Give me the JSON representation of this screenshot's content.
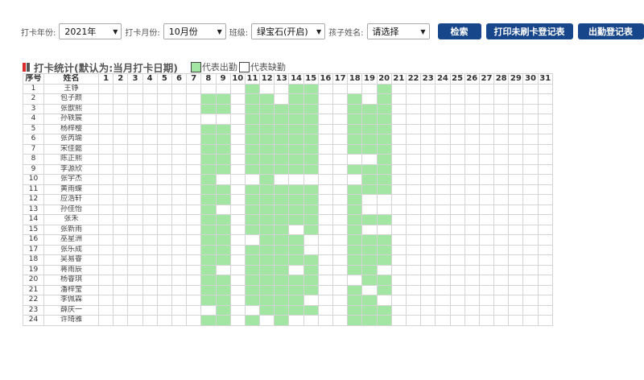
{
  "filters": {
    "year_label": "打卡年份:",
    "year_value": "2021年",
    "month_label": "打卡月份:",
    "month_value": "10月份",
    "class_label": "班级:",
    "class_value": "绿宝石(开启)",
    "child_label": "孩子姓名:",
    "child_value": "请选择"
  },
  "buttons": {
    "search": "检索",
    "print_unswiped": "打印未刷卡登记表",
    "attendance_register": "出勤登记表"
  },
  "section": {
    "title": "打卡统计(默认为:当月打卡日期)",
    "legend_present": "代表出勤",
    "legend_absent": "代表缺勤",
    "accent_colors": [
      "#d92b2b",
      "#555555"
    ]
  },
  "colors": {
    "present": "#a3e6a3",
    "button": "#17478a"
  },
  "table": {
    "headers": {
      "seq": "序号",
      "name": "姓名"
    },
    "days": [
      1,
      2,
      3,
      4,
      5,
      6,
      7,
      8,
      9,
      10,
      11,
      12,
      13,
      14,
      15,
      16,
      17,
      18,
      19,
      20,
      21,
      22,
      23,
      24,
      25,
      26,
      27,
      28,
      29,
      30,
      31
    ],
    "rows": [
      {
        "seq": "1",
        "name": "王铮",
        "present": [
          11,
          14,
          15,
          20
        ]
      },
      {
        "seq": "2",
        "name": "包子颜",
        "present": [
          8,
          9,
          11,
          12,
          14,
          15,
          18,
          20
        ]
      },
      {
        "seq": "3",
        "name": "张歆熙",
        "present": [
          8,
          9,
          11,
          12,
          13,
          14,
          15,
          18,
          19,
          20
        ]
      },
      {
        "seq": "4",
        "name": "孙轶宸",
        "present": [
          11,
          12,
          13,
          14,
          15,
          18,
          19,
          20
        ]
      },
      {
        "seq": "5",
        "name": "杨梓樱",
        "present": [
          8,
          9,
          11,
          12,
          13,
          14,
          15,
          18,
          19,
          20
        ]
      },
      {
        "seq": "6",
        "name": "张芮瑜",
        "present": [
          8,
          9,
          11,
          12,
          13,
          14,
          15,
          18,
          19,
          20
        ]
      },
      {
        "seq": "7",
        "name": "宋佳懿",
        "present": [
          8,
          9,
          11,
          12,
          13,
          14,
          15,
          18,
          19,
          20
        ]
      },
      {
        "seq": "8",
        "name": "陈正熙",
        "present": [
          8,
          9,
          11,
          12,
          13,
          14,
          15,
          20
        ]
      },
      {
        "seq": "9",
        "name": "李源欣",
        "present": [
          8,
          9,
          11,
          12,
          13,
          14,
          15,
          18,
          19,
          20
        ]
      },
      {
        "seq": "10",
        "name": "张宇杰",
        "present": [
          8,
          12,
          19,
          20
        ]
      },
      {
        "seq": "11",
        "name": "黄雨蝶",
        "present": [
          8,
          9,
          11,
          12,
          13,
          14,
          15,
          18,
          19,
          20
        ]
      },
      {
        "seq": "12",
        "name": "应浩轩",
        "present": [
          8,
          9,
          11,
          12,
          13,
          14,
          15,
          18
        ]
      },
      {
        "seq": "13",
        "name": "孙佳怡",
        "present": [
          8,
          11,
          12,
          13,
          14,
          15,
          18
        ]
      },
      {
        "seq": "14",
        "name": "张禾",
        "present": [
          8,
          9,
          11,
          12,
          13,
          14,
          15,
          18,
          19,
          20
        ]
      },
      {
        "seq": "15",
        "name": "张新雨",
        "present": [
          8,
          9,
          11,
          12,
          13,
          15,
          18
        ]
      },
      {
        "seq": "16",
        "name": "巫星洲",
        "present": [
          8,
          9,
          12,
          13,
          14,
          18,
          19,
          20
        ]
      },
      {
        "seq": "17",
        "name": "张乐成",
        "present": [
          8,
          9,
          11,
          12,
          13,
          14,
          18,
          19,
          20
        ]
      },
      {
        "seq": "18",
        "name": "吴易睿",
        "present": [
          8,
          9,
          11,
          12,
          13,
          14,
          15,
          18,
          19,
          20
        ]
      },
      {
        "seq": "19",
        "name": "蒋雨辰",
        "present": [
          8,
          11,
          12,
          13,
          15,
          18,
          19
        ]
      },
      {
        "seq": "20",
        "name": "杨睿琪",
        "present": [
          8,
          9,
          11,
          12,
          13,
          14,
          15,
          19,
          20
        ]
      },
      {
        "seq": "21",
        "name": "潘梓莹",
        "present": [
          8,
          9,
          11,
          12,
          13,
          14,
          15,
          18,
          20
        ]
      },
      {
        "seq": "22",
        "name": "李佩霖",
        "present": [
          8,
          9,
          11,
          12,
          13,
          14,
          18,
          19
        ]
      },
      {
        "seq": "23",
        "name": "薛庆一",
        "present": [
          9,
          12,
          13,
          14,
          15,
          18,
          19,
          20
        ]
      },
      {
        "seq": "24",
        "name": "许琦雅",
        "present": [
          8,
          9,
          11,
          13,
          18,
          19,
          20
        ]
      }
    ]
  }
}
